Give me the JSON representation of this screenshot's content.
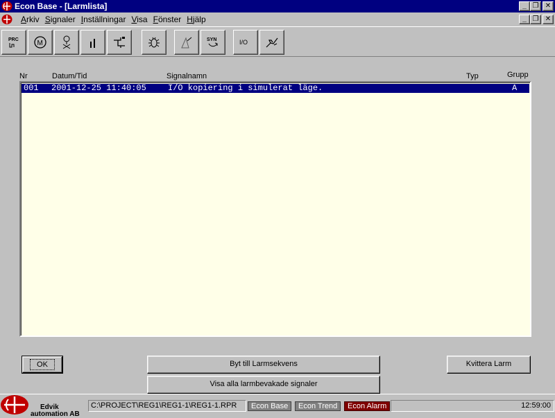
{
  "window": {
    "title": "Econ Base - [Larmlista]",
    "min_glyph": "_",
    "restore_glyph": "❐",
    "close_glyph": "✕"
  },
  "menu": [
    {
      "prefix": "",
      "underline": "A",
      "rest": "rkiv"
    },
    {
      "prefix": "",
      "underline": "S",
      "rest": "ignaler"
    },
    {
      "prefix": "",
      "underline": "I",
      "rest": "nställningar"
    },
    {
      "prefix": "",
      "underline": "V",
      "rest": "isa"
    },
    {
      "prefix": "",
      "underline": "F",
      "rest": "önster"
    },
    {
      "prefix": "",
      "underline": "H",
      "rest": "jälp"
    }
  ],
  "toolbar": {
    "buttons": [
      {
        "icon": "prc-icon",
        "text": "PRC"
      },
      {
        "icon": "motor-icon",
        "text": "M"
      },
      {
        "icon": "valve-icon",
        "text": ""
      },
      {
        "icon": "bar-icon",
        "text": ""
      },
      {
        "icon": "pipe-icon",
        "text": ""
      },
      {
        "icon": "bug-icon",
        "text": ""
      },
      {
        "icon": "pen-icon",
        "text": ""
      },
      {
        "icon": "syn-icon",
        "text": "SYN"
      },
      {
        "icon": "io-icon",
        "text": "I/O"
      },
      {
        "icon": "hand-icon",
        "text": ""
      }
    ]
  },
  "columns": {
    "nr": "Nr",
    "datetime": "Datum/Tid",
    "signal": "Signalnamn",
    "type": "Typ",
    "group": "Grupp"
  },
  "alarms": [
    {
      "nr": "001",
      "datetime": "2001-12-25 11:40:05",
      "signal": "I/O kopiering i simulerat läge.",
      "type": "",
      "group": "A"
    }
  ],
  "buttons": {
    "ok": "OK",
    "switch_sequence": "Byt till Larmsekvens",
    "acknowledge": "Kvittera Larm",
    "show_blocked": "Visa alla larmbevakade signaler"
  },
  "status": {
    "company_line1": "Edvik",
    "company_line2": "automation AB",
    "path": "C:\\PROJECT\\REG1\\REG1-1\\REG1-1.RPR",
    "apps": [
      "Econ Base",
      "Econ Trend",
      "Econ Alarm"
    ],
    "time": "12:59:00"
  },
  "colors": {
    "titlebar": "#000080",
    "selection": "#000080",
    "list_bg": "#ffffe8",
    "logo_red": "#c00000",
    "alarm_tag": "#800000"
  }
}
